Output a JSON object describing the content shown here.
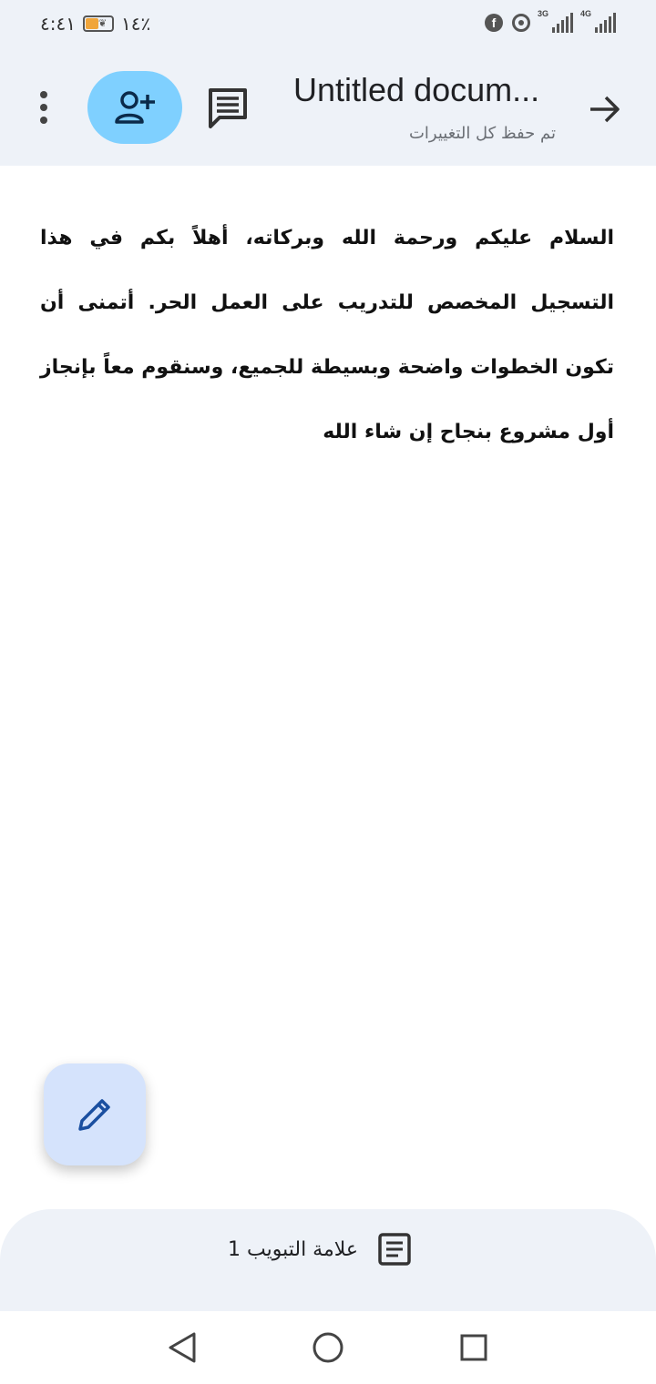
{
  "status_bar": {
    "time": "٤:٤١",
    "battery": "١٤٪",
    "network_1": "3G",
    "network_2": "4G"
  },
  "app_bar": {
    "title": "Untitled docum...",
    "save_status": "تم حفظ كل التغييرات"
  },
  "document": {
    "body": "السلام عليكم ورحمة الله وبركاته، أهلاً بكم في هذا التسجيل المخصص للتدريب على العمل الحر. أتمنى أن تكون الخطوات واضحة وبسيطة للجميع، وسنقوم معاً بإنجاز أول مشروع بنجاح إن شاء الله"
  },
  "tab_bar": {
    "tab_label": "علامة التبويب 1"
  },
  "colors": {
    "app_bar_bg": "#eef2f8",
    "share_button_bg": "#7fd0ff",
    "fab_bg": "#d5e3fc",
    "pencil_icon": "#1a4fa0"
  },
  "icons": {
    "menu": "more-vert-icon",
    "share": "person-add-icon",
    "comments": "comment-icon",
    "back": "arrow-forward-icon",
    "edit": "pencil-icon",
    "tab": "document-outline-icon"
  }
}
